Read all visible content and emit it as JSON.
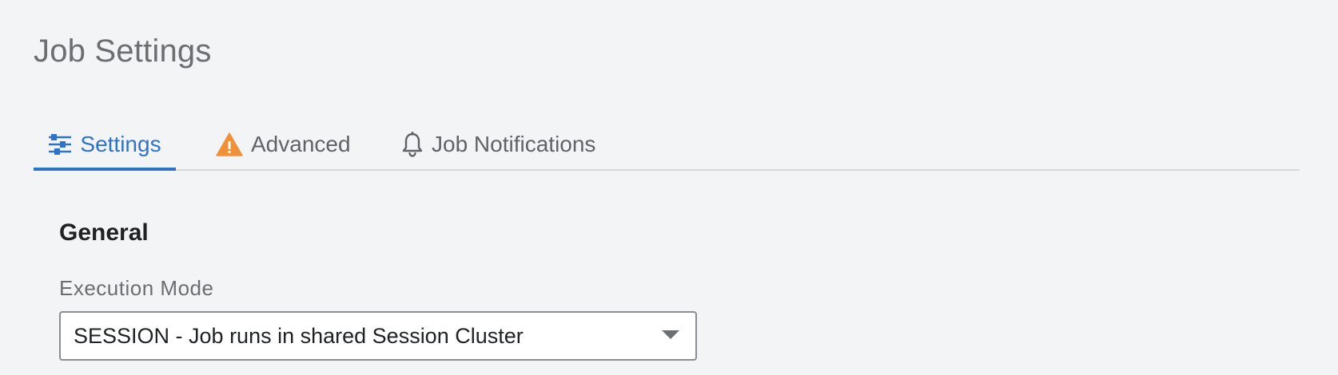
{
  "page": {
    "title": "Job Settings"
  },
  "tabs": [
    {
      "label": "Settings",
      "icon": "sliders-icon",
      "active": true
    },
    {
      "label": "Advanced",
      "icon": "warning-icon",
      "active": false
    },
    {
      "label": "Job Notifications",
      "icon": "bell-icon",
      "active": false
    }
  ],
  "general": {
    "section_title": "General",
    "execution_mode": {
      "label": "Execution Mode",
      "value": "SESSION - Job runs in shared Session Cluster"
    }
  },
  "colors": {
    "accent": "#2f73c8",
    "warning": "#f0913a",
    "background": "#f3f4f6"
  }
}
